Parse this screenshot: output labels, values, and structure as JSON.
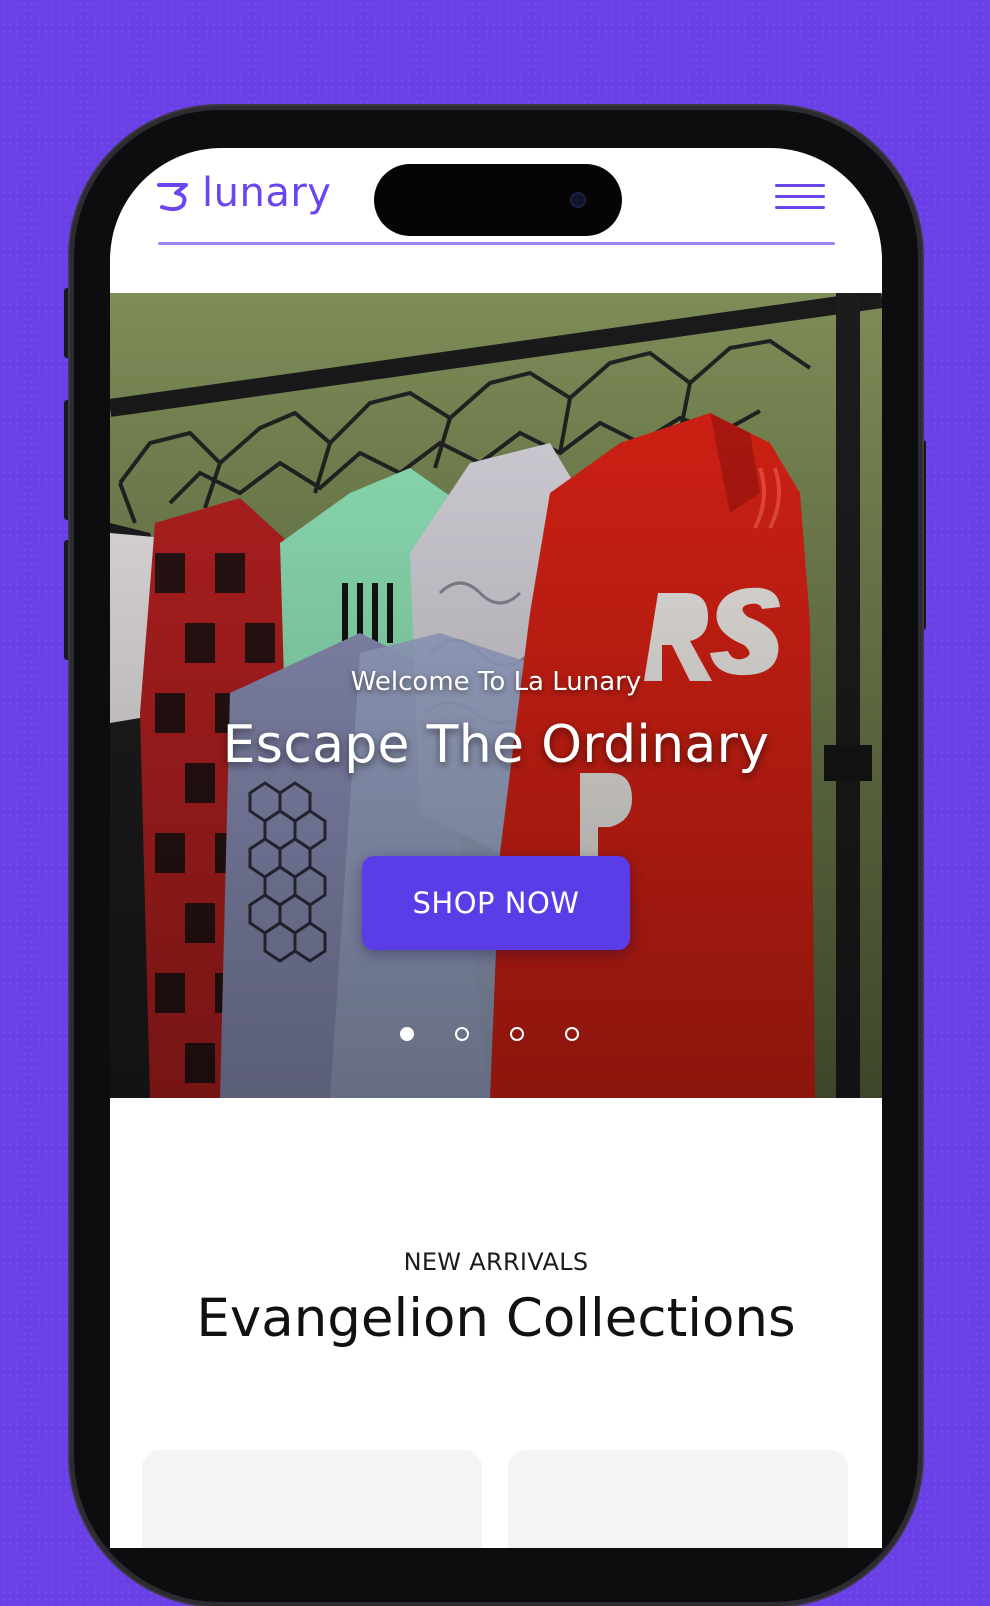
{
  "colors": {
    "accent": "#6b46f0",
    "button": "#5b3de8",
    "page_background": "#6a3fe6",
    "hero_wall": "#7a8a57"
  },
  "header": {
    "logo_text": "lunary",
    "logo_icon": "brand-moon-icon",
    "menu_icon": "hamburger-menu-icon"
  },
  "hero": {
    "subtitle": "Welcome To La Lunary",
    "title": "Escape The Ordinary",
    "cta_label": "SHOP NOW",
    "slide_count": 4,
    "active_slide": 1
  },
  "section": {
    "kicker": "NEW ARRIVALS",
    "title": "Evangelion Collections"
  }
}
